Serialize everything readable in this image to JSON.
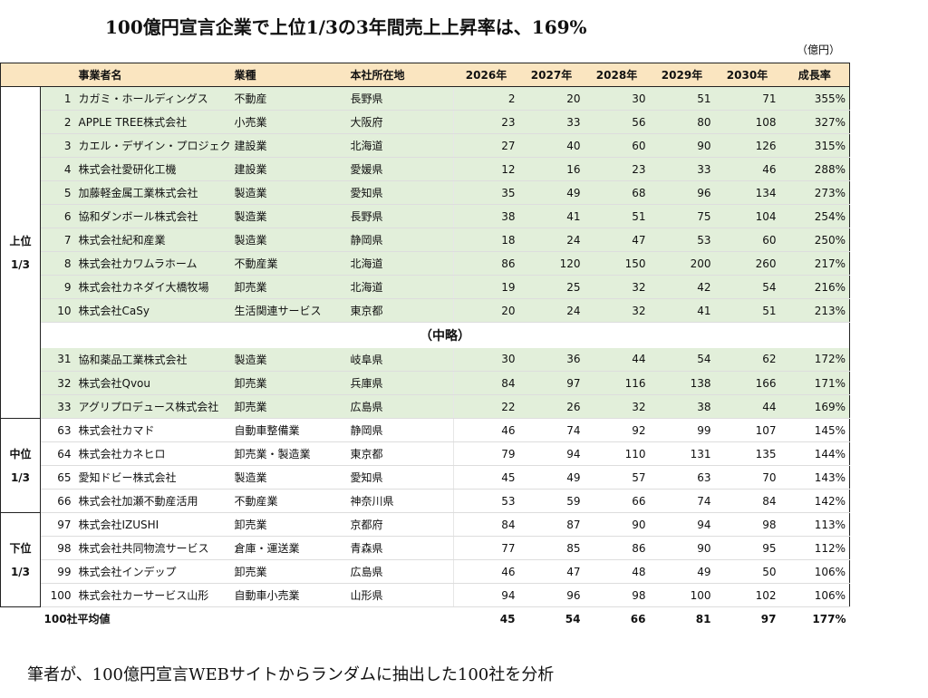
{
  "title": "100億円宣言企業で上位1/3の3年間売上上昇率は、169%",
  "unit": "（億円）",
  "footer": "筆者が、100億円宣言WEBサイトからランダムに抽出した100社を分析",
  "headers": [
    "",
    "",
    "事業者名",
    "業種",
    "本社所在地",
    "2026年",
    "2027年",
    "2028年",
    "2029年",
    "2030年",
    "成長率"
  ],
  "groups": {
    "top": [
      "上位",
      "1/3"
    ],
    "mid": [
      "中位",
      "1/3"
    ],
    "low": [
      "下位",
      "1/3"
    ]
  },
  "omitted": "（中略）",
  "top_rows": [
    [
      "1",
      "カガミ・ホールディングス",
      "不動産",
      "長野県",
      "2",
      "20",
      "30",
      "51",
      "71",
      "355%"
    ],
    [
      "2",
      "APPLE TREE株式会社",
      "小売業",
      "大阪府",
      "23",
      "33",
      "56",
      "80",
      "108",
      "327%"
    ],
    [
      "3",
      "カエル・デザイン・プロジェクト",
      "建設業",
      "北海道",
      "27",
      "40",
      "60",
      "90",
      "126",
      "315%"
    ],
    [
      "4",
      "株式会社愛研化工機",
      "建設業",
      "愛媛県",
      "12",
      "16",
      "23",
      "33",
      "46",
      "288%"
    ],
    [
      "5",
      "加藤軽金属工業株式会社",
      "製造業",
      "愛知県",
      "35",
      "49",
      "68",
      "96",
      "134",
      "273%"
    ],
    [
      "6",
      "協和ダンボール株式会社",
      "製造業",
      "長野県",
      "38",
      "41",
      "51",
      "75",
      "104",
      "254%"
    ],
    [
      "7",
      "株式会社紀和産業",
      "製造業",
      "静岡県",
      "18",
      "24",
      "47",
      "53",
      "60",
      "250%"
    ],
    [
      "8",
      "株式会社カワムラホーム",
      "不動産業",
      "北海道",
      "86",
      "120",
      "150",
      "200",
      "260",
      "217%"
    ],
    [
      "9",
      "株式会社カネダイ大橋牧場",
      "卸売業",
      "北海道",
      "19",
      "25",
      "32",
      "42",
      "54",
      "216%"
    ],
    [
      "10",
      "株式会社CaSy",
      "生活関連サービス",
      "東京都",
      "20",
      "24",
      "32",
      "41",
      "51",
      "213%"
    ]
  ],
  "top_rows_2": [
    [
      "31",
      "協和薬品工業株式会社",
      "製造業",
      "岐阜県",
      "30",
      "36",
      "44",
      "54",
      "62",
      "172%"
    ],
    [
      "32",
      "株式会社Qvou",
      "卸売業",
      "兵庫県",
      "84",
      "97",
      "116",
      "138",
      "166",
      "171%"
    ],
    [
      "33",
      "アグリプロデュース株式会社",
      "卸売業",
      "広島県",
      "22",
      "26",
      "32",
      "38",
      "44",
      "169%"
    ]
  ],
  "mid_rows": [
    [
      "63",
      "株式会社カマド",
      "自動車整備業",
      "静岡県",
      "46",
      "74",
      "92",
      "99",
      "107",
      "145%"
    ],
    [
      "64",
      "株式会社カネヒロ",
      "卸売業・製造業",
      "東京都",
      "79",
      "94",
      "110",
      "131",
      "135",
      "144%"
    ],
    [
      "65",
      "愛知ドビー株式会社",
      "製造業",
      "愛知県",
      "45",
      "49",
      "57",
      "63",
      "70",
      "143%"
    ],
    [
      "66",
      "株式会社加瀬不動産活用",
      "不動産業",
      "神奈川県",
      "53",
      "59",
      "66",
      "74",
      "84",
      "142%"
    ]
  ],
  "low_rows": [
    [
      "97",
      "株式会社IZUSHI",
      "卸売業",
      "京都府",
      "84",
      "87",
      "90",
      "94",
      "98",
      "113%"
    ],
    [
      "98",
      "株式会社共同物流サービス",
      "倉庫・運送業",
      "青森県",
      "77",
      "85",
      "86",
      "90",
      "95",
      "112%"
    ],
    [
      "99",
      "株式会社インデップ",
      "卸売業",
      "広島県",
      "46",
      "47",
      "48",
      "49",
      "50",
      "106%"
    ],
    [
      "100",
      "株式会社カーサービス山形",
      "自動車小売業",
      "山形県",
      "94",
      "96",
      "98",
      "100",
      "102",
      "106%"
    ]
  ],
  "average": [
    "100社平均値",
    "45",
    "54",
    "66",
    "81",
    "97",
    "177%"
  ]
}
